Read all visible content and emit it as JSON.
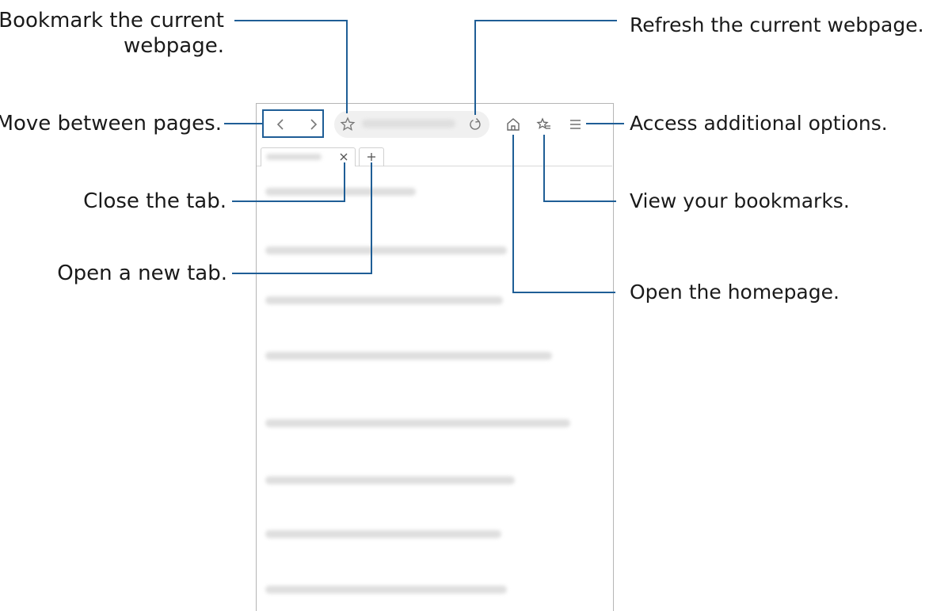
{
  "callouts": {
    "bookmark_line1": "Bookmark the current",
    "bookmark_line2": "webpage.",
    "move": "Move between pages.",
    "close_tab": "Close the tab.",
    "new_tab": "Open a new tab.",
    "refresh": "Refresh the current webpage.",
    "options": "Access additional options.",
    "bookmarks": "View your bookmarks.",
    "homepage": "Open the homepage."
  },
  "browser": {
    "icons": [
      "back-icon",
      "forward-icon",
      "star-icon",
      "refresh-icon",
      "home-icon",
      "bookmarks-icon",
      "menu-icon",
      "close-icon",
      "plus-icon"
    ]
  },
  "colors": {
    "callout_line": "#1f5e96",
    "frame": "#b5b5b5",
    "blurred_text": "#dedede"
  }
}
